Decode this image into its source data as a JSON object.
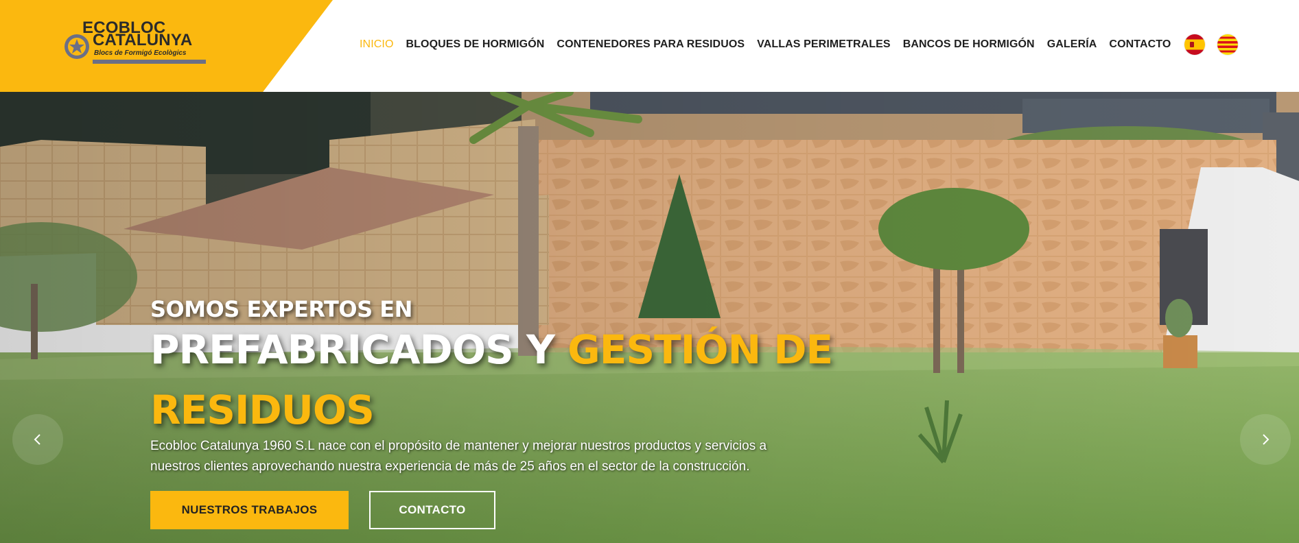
{
  "brand": {
    "line1": "ECOBLOC",
    "line2": "CATALUNYA",
    "tagline": "Blocs de Formigó Ecològics",
    "accent_color": "#fbb80f"
  },
  "nav": {
    "items": [
      {
        "label": "INICIO",
        "active": true
      },
      {
        "label": "BLOQUES DE HORMIGÓN",
        "active": false
      },
      {
        "label": "CONTENEDORES PARA RESIDUOS",
        "active": false
      },
      {
        "label": "VALLAS PERIMETRALES",
        "active": false
      },
      {
        "label": "BANCOS DE HORMIGÓN",
        "active": false
      },
      {
        "label": "GALERÍA",
        "active": false
      },
      {
        "label": "CONTACTO",
        "active": false
      }
    ],
    "languages": [
      {
        "icon": "spain-flag-icon"
      },
      {
        "icon": "catalonia-flag-icon"
      }
    ]
  },
  "hero": {
    "pre_title": "SOMOS EXPERTOS EN",
    "title_white": "PREFABRICADOS Y ",
    "title_accent": "GESTIÓN DE RESIDUOS",
    "description": "Ecobloc Catalunya 1960 S.L nace con el propósito de mantener y mejorar nuestros productos y servicios a nuestros clientes aprovechando nuestra experiencia de más de 25 años en el sector de la construcción.",
    "primary_button": "NUESTROS TRABAJOS",
    "secondary_button": "CONTACTO",
    "prev_icon": "chevron-left-icon",
    "next_icon": "chevron-right-icon"
  }
}
